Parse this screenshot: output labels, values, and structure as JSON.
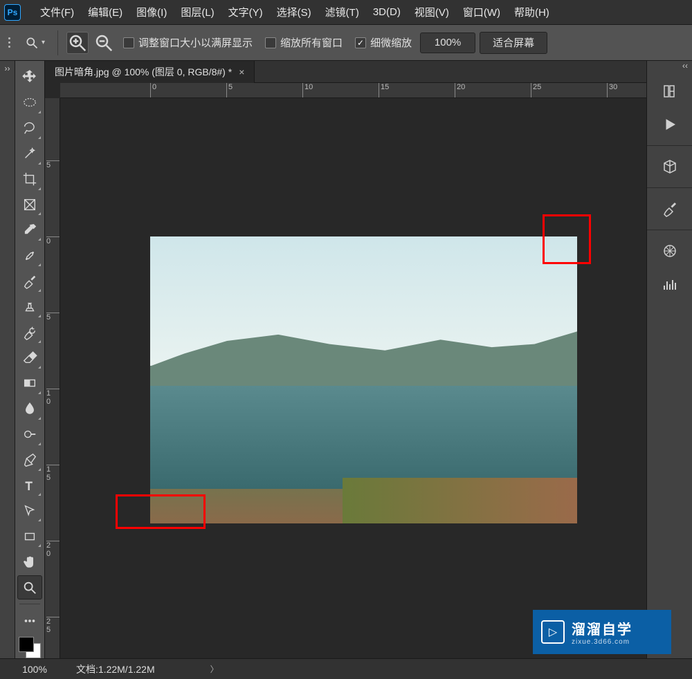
{
  "app": {
    "icon_label": "Ps"
  },
  "menu": {
    "items": [
      "文件(F)",
      "编辑(E)",
      "图像(I)",
      "图层(L)",
      "文字(Y)",
      "选择(S)",
      "滤镜(T)",
      "3D(D)",
      "视图(V)",
      "窗口(W)",
      "帮助(H)"
    ]
  },
  "options": {
    "resize_window_label": "调整窗口大小以满屏显示",
    "zoom_all_label": "缩放所有窗口",
    "scrubby_zoom_label": "细微缩放",
    "scrubby_zoom_checked": true,
    "zoom_value": "100%",
    "fit_screen_label": "适合屏幕"
  },
  "document": {
    "tab_title": "图片暗角.jpg @ 100% (图层 0, RGB/8#) *",
    "close_glyph": "×"
  },
  "ruler": {
    "h_ticks": [
      {
        "pos": 0,
        "label": ""
      },
      {
        "pos": 130,
        "label": "0"
      },
      {
        "pos": 240,
        "label": "5"
      },
      {
        "pos": 350,
        "label": "10"
      },
      {
        "pos": 460,
        "label": "15"
      },
      {
        "pos": 570,
        "label": "20"
      },
      {
        "pos": 680,
        "label": "25"
      },
      {
        "pos": 790,
        "label": "30"
      }
    ],
    "v_ticks": [
      {
        "pos": 90,
        "label": "5"
      },
      {
        "pos": 200,
        "label": "0"
      },
      {
        "pos": 310,
        "label": "5"
      },
      {
        "pos": 420,
        "label": "1\n0"
      },
      {
        "pos": 530,
        "label": "1\n5"
      },
      {
        "pos": 640,
        "label": "2\n0"
      },
      {
        "pos": 750,
        "label": "2\n5"
      }
    ]
  },
  "status": {
    "zoom": "100%",
    "doc_label": "文档:",
    "doc_size": "1.22M/1.22M"
  },
  "watermark": {
    "title": "溜溜自学",
    "sub": "zixue.3d66.com"
  },
  "tools": {
    "names": [
      "move",
      "marquee",
      "lasso",
      "magic-wand",
      "crop",
      "frame",
      "eyedropper",
      "healing",
      "brush",
      "clone",
      "history-brush",
      "eraser",
      "gradient",
      "blur",
      "dodge",
      "pen",
      "type",
      "path-select",
      "rectangle",
      "hand",
      "zoom"
    ]
  },
  "right_icons": [
    "libraries",
    "play",
    "3d",
    "brush",
    "wheel",
    "equalizer"
  ]
}
